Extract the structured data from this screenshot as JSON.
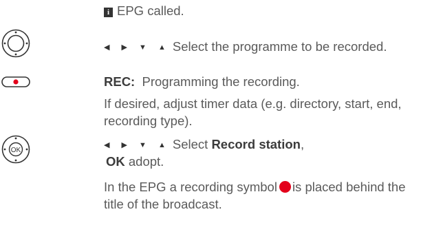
{
  "steps": [
    {
      "info_icon": "i",
      "text": "EPG called."
    },
    {
      "icon": "remote-nav-ring-icon",
      "arrows": "◀ ▶ ▼ ▲",
      "text": "Select the programme to be recorded."
    },
    {
      "icon": "remote-rec-button-icon",
      "key": "REC:",
      "text": "Programming the recording.",
      "note_line1": "If desired, adjust timer data (e.g. directory, start, end,",
      "note_line2": "recording type)."
    },
    {
      "icon": "remote-ok-button-icon",
      "arrows": "◀ ▶ ▼ ▲",
      "text_pre": "Select",
      "text_bold": "Record station",
      "text_post": ",",
      "ok_key": "OK",
      "ok_text": "adopt."
    },
    {
      "result_line1_pre": "In the EPG a recording symbol",
      "result_line1_post": "is placed behind the",
      "result_line2": "title of the broadcast."
    }
  ],
  "colors": {
    "rec_dot": "#e3001b",
    "text": "#5a5a5a"
  }
}
